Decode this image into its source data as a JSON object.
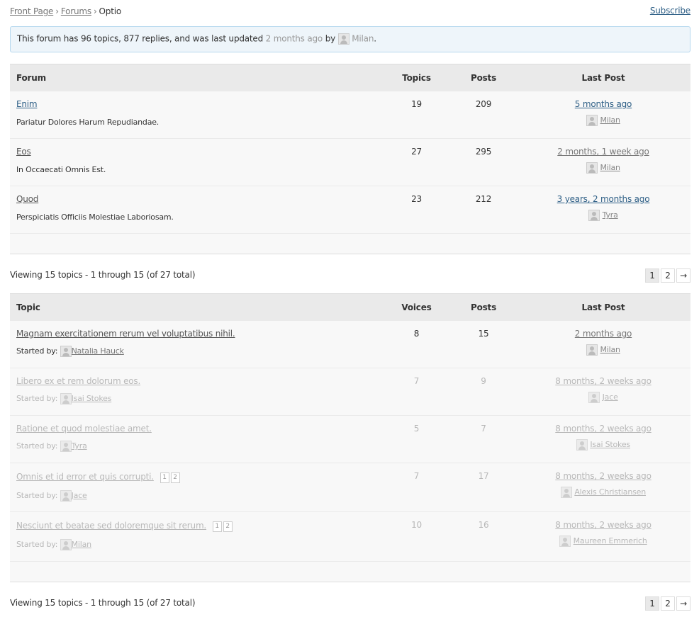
{
  "breadcrumb": {
    "front_page": "Front Page",
    "sep": "›",
    "forums": "Forums",
    "current": "Optio"
  },
  "subscribe": "Subscribe",
  "info": {
    "prefix": "This forum has 96 topics, 877 replies, and was last updated",
    "time": "2 months ago",
    "by": "by",
    "user": "Milan",
    "suffix": "."
  },
  "forums_table": {
    "headers": {
      "forum": "Forum",
      "topics": "Topics",
      "posts": "Posts",
      "last_post": "Last Post"
    },
    "rows": [
      {
        "title": "Enim",
        "desc": "Pariatur Dolores Harum Repudiandae.",
        "topics": "19",
        "posts": "209",
        "last_post": "5 months ago",
        "last_user": "Milan"
      },
      {
        "title": "Eos",
        "desc": "In Occaecati Omnis Est.",
        "topics": "27",
        "posts": "295",
        "last_post": "2 months, 1 week ago",
        "last_user": "Milan"
      },
      {
        "title": "Quod",
        "desc": "Perspiciatis Officiis Molestiae Laboriosam.",
        "topics": "23",
        "posts": "212",
        "last_post": "3 years, 2 months ago",
        "last_user": "Tyra"
      }
    ]
  },
  "pagination": {
    "count_text": "Viewing 15 topics - 1 through 15 (of 27 total)",
    "pages": [
      "1",
      "2"
    ],
    "next": "→"
  },
  "topics_table": {
    "headers": {
      "topic": "Topic",
      "voices": "Voices",
      "posts": "Posts",
      "last_post": "Last Post"
    },
    "started_by": "Started by:",
    "rows": [
      {
        "title": "Magnam exercitationem rerum vel voluptatibus nihil.",
        "author": "Natalia Hauck",
        "voices": "8",
        "posts": "15",
        "last_post": "2 months ago",
        "last_user": "Milan"
      },
      {
        "title": "Libero ex et rem dolorum eos.",
        "author": "Isai Stokes",
        "voices": "7",
        "posts": "9",
        "last_post": "8 months, 2 weeks ago",
        "last_user": "Jace"
      },
      {
        "title": "Ratione et quod molestiae amet.",
        "author": "Tyra",
        "voices": "5",
        "posts": "7",
        "last_post": "8 months, 2 weeks ago",
        "last_user": "Isai Stokes"
      },
      {
        "title": "Omnis et id error et quis corrupti.",
        "mini_pages": [
          "1",
          "2"
        ],
        "author": "Jace",
        "voices": "7",
        "posts": "17",
        "last_post": "8 months, 2 weeks ago",
        "last_user": "Alexis Christiansen"
      },
      {
        "title": "Nesciunt et beatae sed doloremque sit rerum.",
        "mini_pages": [
          "1",
          "2"
        ],
        "author": "Milan",
        "voices": "10",
        "posts": "16",
        "last_post": "8 months, 2 weeks ago",
        "last_user": "Maureen Emmerich"
      }
    ]
  }
}
